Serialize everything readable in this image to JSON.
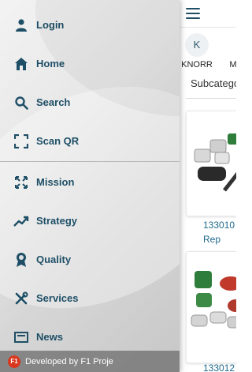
{
  "drawer": {
    "menu_top": [
      {
        "label": "Login",
        "icon": "user-icon"
      },
      {
        "label": "Home",
        "icon": "home-icon"
      },
      {
        "label": "Search",
        "icon": "search-icon"
      },
      {
        "label": "Scan QR",
        "icon": "scan-qr-icon"
      }
    ],
    "menu_bottom": [
      {
        "label": "Mission",
        "icon": "mission-icon"
      },
      {
        "label": "Strategy",
        "icon": "trending-up-icon"
      },
      {
        "label": "Quality",
        "icon": "award-icon"
      },
      {
        "label": "Services",
        "icon": "tools-icon"
      },
      {
        "label": "News",
        "icon": "news-icon"
      }
    ],
    "footer": {
      "logo_text": "F1",
      "text": "Developed by F1 Proje"
    }
  },
  "content": {
    "brands": [
      {
        "initial": "K",
        "label": "KNORR"
      },
      {
        "initial": "",
        "label": "M"
      }
    ],
    "subcategory_label": "Subcategories",
    "products": [
      {
        "code": "133010",
        "desc": "Rep"
      },
      {
        "code": "133012"
      }
    ]
  },
  "colors": {
    "accent": "#1e4f66",
    "link": "#1e6a8c",
    "logo": "#d9381e"
  }
}
